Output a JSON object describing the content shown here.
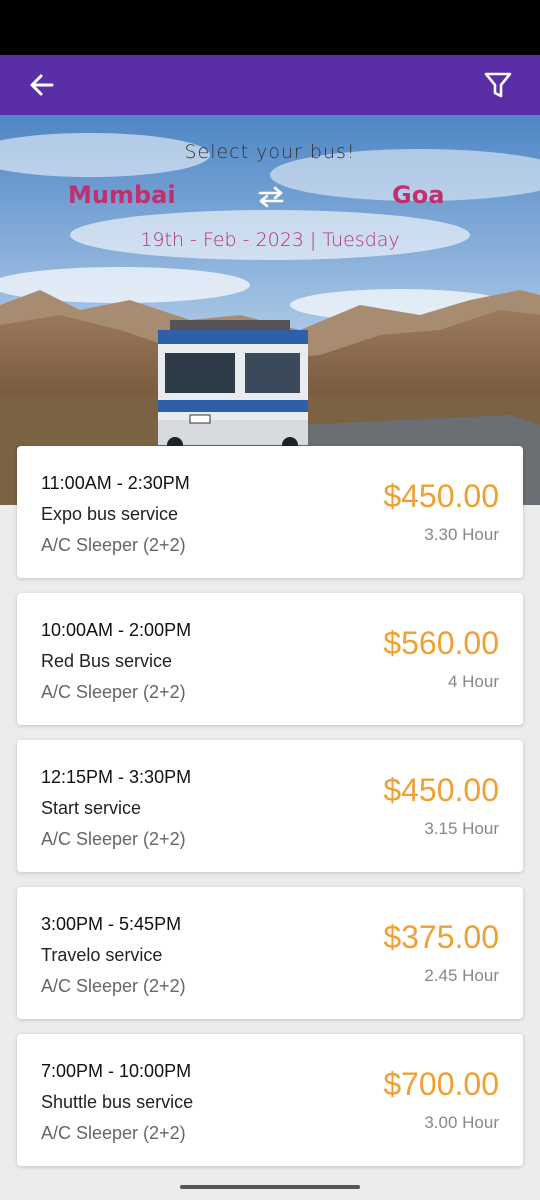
{
  "header": {
    "back_icon": "arrow-left-icon",
    "filter_icon": "funnel-filter-icon",
    "accent_color": "#5a2ea6"
  },
  "hero": {
    "title": "Select your bus!",
    "from": "Mumbai",
    "to": "Goa",
    "swap_icon": "swap-arrows-icon",
    "date": "19th - Feb - 2023 | Tuesday",
    "city_color": "#c0306e"
  },
  "buses": [
    {
      "time": "11:00AM - 2:30PM",
      "name": "Expo bus service",
      "type": "A/C Sleeper (2+2)",
      "price": "$450.00",
      "duration": "3.30 Hour"
    },
    {
      "time": "10:00AM - 2:00PM",
      "name": "Red Bus service",
      "type": "A/C Sleeper (2+2)",
      "price": "$560.00",
      "duration": "4 Hour"
    },
    {
      "time": "12:15PM - 3:30PM",
      "name": "Start service",
      "type": "A/C Sleeper (2+2)",
      "price": "$450.00",
      "duration": "3.15 Hour"
    },
    {
      "time": "3:00PM - 5:45PM",
      "name": "Travelo service",
      "type": "A/C Sleeper (2+2)",
      "price": "$375.00",
      "duration": "2.45 Hour"
    },
    {
      "time": "7:00PM - 10:00PM",
      "name": "Shuttle bus service",
      "type": "A/C Sleeper (2+2)",
      "price": "$700.00",
      "duration": "3.00 Hour"
    }
  ],
  "price_color": "#f0a032"
}
